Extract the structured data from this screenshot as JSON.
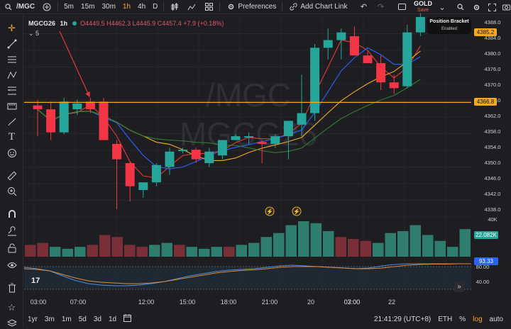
{
  "toolbar": {
    "symbol": "/MGC",
    "intervals": [
      "5m",
      "15m",
      "30m",
      "1h",
      "4h",
      "D"
    ],
    "active_interval": "1h",
    "preferences": "Preferences",
    "add_chart_link": "Add Chart Link",
    "gold_label": "GOLD",
    "gold_sub": "Save"
  },
  "legend": {
    "symbol": "MGCG26",
    "interval": "1h",
    "o": "O4449.5",
    "h": "H4462.3",
    "l": "L4445.9",
    "c": "C4457.4",
    "chg": "+7.9 (+0.18%)",
    "collapse_count": "5"
  },
  "watermark": {
    "line1": "/MGC",
    "line2": "MGCG26"
  },
  "position_bracket": {
    "title": "Position Bracket",
    "status": "Enabled"
  },
  "price_axis": {
    "ticks": [
      "4388.0",
      "4384.0",
      "4380.0",
      "4376.0",
      "4370.0",
      "4366.0",
      "4362.0",
      "4358.0",
      "4354.0",
      "4350.0",
      "4346.0",
      "4342.0",
      "4338.0"
    ],
    "tags": [
      {
        "label": "4385.2",
        "bg": "#f7a823",
        "fg": "#111111"
      },
      {
        "label": "4366.8",
        "bg": "#f7a823",
        "fg": "#111111"
      }
    ],
    "volume_label": "40K",
    "volume_tag": "22.082K",
    "osc_tag": "93.33",
    "osc_ticks": [
      "80.00",
      "40.00"
    ]
  },
  "time_axis": [
    "03:00",
    "07:00",
    "12:00",
    "15:00",
    "18:00",
    "21:00",
    "20",
    "03:00",
    "07:00",
    "22"
  ],
  "bottom_bar": {
    "ranges": [
      "1yr",
      "3m",
      "1m",
      "5d",
      "3d",
      "1d"
    ],
    "clock": "21:41:29 (UTC+8)",
    "session": "ETH",
    "percent": "%",
    "log": "log",
    "auto": "auto"
  },
  "colors": {
    "up": "#26a69a",
    "down": "#f23645",
    "level_line": "#f7a823",
    "ma_blue": "#2962ff",
    "ma_red": "#e53935",
    "ma_orange": "#f7a823",
    "ma_green": "#2e7d32"
  },
  "chart_data": {
    "type": "candlestick",
    "price_range": [
      4337,
      4389
    ],
    "level": 4366.8,
    "candles": [
      {
        "o": 4366.0,
        "h": 4367.5,
        "l": 4358.0,
        "c": 4365.0
      },
      {
        "o": 4365.0,
        "h": 4367.0,
        "l": 4357.0,
        "c": 4359.0
      },
      {
        "o": 4359.0,
        "h": 4368.0,
        "l": 4358.5,
        "c": 4367.0
      },
      {
        "o": 4365.0,
        "h": 4367.5,
        "l": 4363.5,
        "c": 4366.5
      },
      {
        "o": 4367.0,
        "h": 4368.0,
        "l": 4364.0,
        "c": 4365.0
      },
      {
        "o": 4367.0,
        "h": 4368.0,
        "l": 4357.0,
        "c": 4357.0
      },
      {
        "o": 4356.0,
        "h": 4357.0,
        "l": 4339.0,
        "c": 4352.0
      },
      {
        "o": 4351.0,
        "h": 4351.5,
        "l": 4341.0,
        "c": 4345.0
      },
      {
        "o": 4344.0,
        "h": 4346.0,
        "l": 4342.0,
        "c": 4346.0
      },
      {
        "o": 4346.0,
        "h": 4351.0,
        "l": 4345.0,
        "c": 4350.5
      },
      {
        "o": 4350.0,
        "h": 4355.0,
        "l": 4348.0,
        "c": 4354.0
      },
      {
        "o": 4354.5,
        "h": 4355.0,
        "l": 4353.5,
        "c": 4354.5
      },
      {
        "o": 4354.5,
        "h": 4355.0,
        "l": 4351.0,
        "c": 4352.0
      },
      {
        "o": 4351.0,
        "h": 4355.0,
        "l": 4350.0,
        "c": 4354.0
      },
      {
        "o": 4353.0,
        "h": 4357.0,
        "l": 4352.0,
        "c": 4357.0
      },
      {
        "o": 4357.0,
        "h": 4358.5,
        "l": 4357.0,
        "c": 4358.0
      },
      {
        "o": 4358.0,
        "h": 4359.0,
        "l": 4356.0,
        "c": 4358.0
      },
      {
        "o": 4356.5,
        "h": 4357.0,
        "l": 4351.0,
        "c": 4356.0
      },
      {
        "o": 4356.0,
        "h": 4358.5,
        "l": 4355.0,
        "c": 4358.0
      },
      {
        "o": 4358.0,
        "h": 4359.0,
        "l": 4352.0,
        "c": 4362.0
      },
      {
        "o": 4361.0,
        "h": 4374.0,
        "l": 4358.0,
        "c": 4364.0
      },
      {
        "o": 4364.0,
        "h": 4382.0,
        "l": 4362.0,
        "c": 4381.0
      },
      {
        "o": 4381.0,
        "h": 4386.0,
        "l": 4378.0,
        "c": 4383.0
      },
      {
        "o": 4383.0,
        "h": 4386.0,
        "l": 4378.0,
        "c": 4385.0
      },
      {
        "o": 4384.0,
        "h": 4386.5,
        "l": 4379.0,
        "c": 4379.0
      },
      {
        "o": 4379.0,
        "h": 4380.0,
        "l": 4377.0,
        "c": 4377.0
      },
      {
        "o": 4377.0,
        "h": 4379.0,
        "l": 4370.0,
        "c": 4372.0
      },
      {
        "o": 4372.0,
        "h": 4374.0,
        "l": 4369.0,
        "c": 4370.5
      },
      {
        "o": 4371.0,
        "h": 4387.0,
        "l": 4370.5,
        "c": 4385.0
      },
      {
        "o": 4385.0,
        "h": 4390.0,
        "l": 4384.0,
        "c": 4389.0
      }
    ],
    "volume": [
      6,
      7,
      5,
      4,
      5,
      6,
      11,
      10,
      6,
      5,
      6,
      7,
      6,
      5,
      4,
      5,
      5,
      6,
      7,
      10,
      12,
      16,
      18,
      17,
      13,
      10,
      9,
      8,
      7,
      12,
      13,
      16,
      11,
      8,
      5,
      14
    ],
    "volume_up": [
      false,
      false,
      true,
      true,
      true,
      false,
      false,
      false,
      false,
      false,
      true,
      true,
      false,
      true,
      true,
      true,
      false,
      true,
      true,
      true,
      true,
      true,
      true,
      true,
      true,
      false,
      false,
      false,
      true,
      true,
      true,
      true,
      true,
      true,
      true,
      true
    ],
    "osc_blue": [
      82,
      78,
      72,
      58,
      45,
      36,
      32,
      30,
      30,
      32,
      36,
      42,
      50,
      58,
      64,
      70,
      74,
      76,
      78,
      82,
      86,
      88,
      86,
      84,
      82,
      80,
      78,
      80,
      86,
      90,
      93,
      95,
      95,
      94,
      93,
      93
    ],
    "osc_orange": [
      78,
      76,
      72,
      62,
      52,
      44,
      40,
      38,
      36,
      36,
      38,
      42,
      48,
      54,
      60,
      66,
      70,
      73,
      75,
      78,
      82,
      84,
      84,
      84,
      82,
      80,
      78,
      78,
      80,
      84,
      88,
      90,
      91,
      91,
      92,
      92
    ]
  }
}
